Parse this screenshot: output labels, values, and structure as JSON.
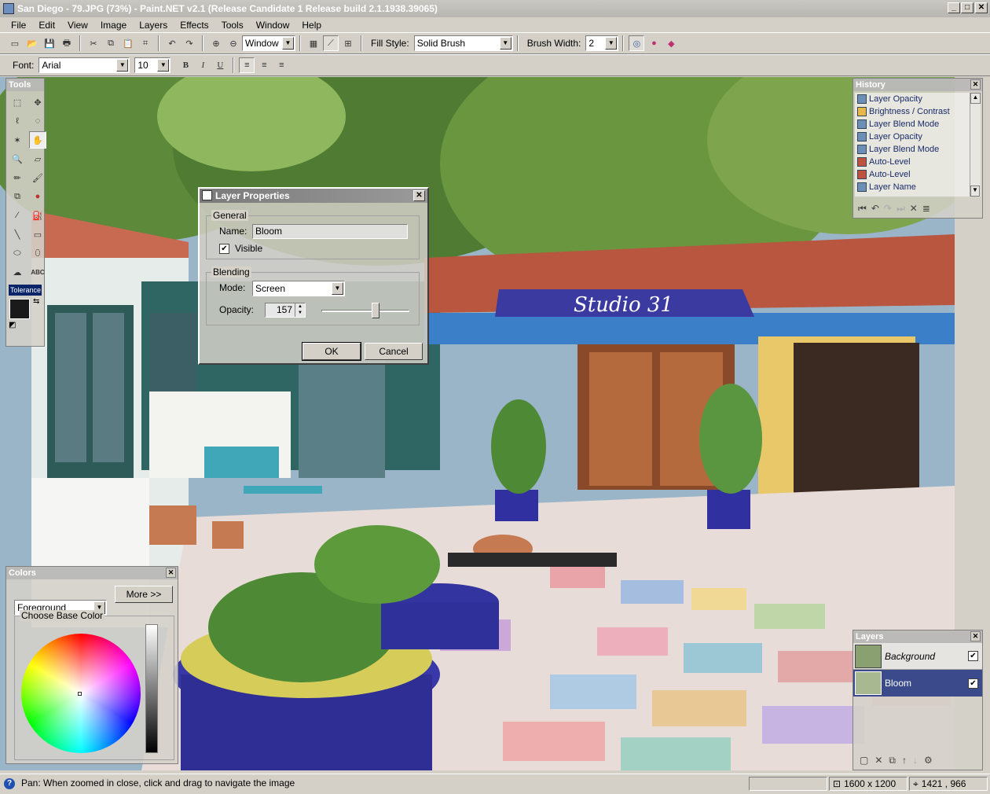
{
  "window": {
    "title": "San Diego - 79.JPG (73%) - Paint.NET v2.1 (Release Candidate 1 Release build 2.1.1938.39065)"
  },
  "menu": [
    "File",
    "Edit",
    "View",
    "Image",
    "Layers",
    "Effects",
    "Tools",
    "Window",
    "Help"
  ],
  "toolbar1": {
    "view_combo": "Window",
    "fill_style_label": "Fill Style:",
    "fill_style_value": "Solid Brush",
    "brush_width_label": "Brush Width:",
    "brush_width_value": "2"
  },
  "toolbar2": {
    "font_label": "Font:",
    "font_value": "Arial",
    "size_value": "10",
    "bold": "B",
    "italic": "I",
    "underline": "U"
  },
  "tools_panel": {
    "title": "Tools",
    "tolerance": "Tolerance"
  },
  "history_panel": {
    "title": "History",
    "items": [
      "Layer Opacity",
      "Brightness / Contrast",
      "Layer Blend Mode",
      "Layer Opacity",
      "Layer Blend Mode",
      "Auto-Level",
      "Auto-Level",
      "Layer Name"
    ]
  },
  "layers_panel": {
    "title": "Layers",
    "layers": [
      {
        "name": "Background",
        "visible": true,
        "selected": false
      },
      {
        "name": "Bloom",
        "visible": true,
        "selected": true
      }
    ]
  },
  "colors_panel": {
    "title": "Colors",
    "target": "Foreground",
    "more_button": "More >>",
    "group_label": "Choose Base Color"
  },
  "dialog": {
    "title": "Layer Properties",
    "general_label": "General",
    "name_label": "Name:",
    "name_value": "Bloom",
    "visible_label": "Visible",
    "blending_label": "Blending",
    "mode_label": "Mode:",
    "mode_value": "Screen",
    "opacity_label": "Opacity:",
    "opacity_value": "157",
    "opacity_fraction": 0.62,
    "ok": "OK",
    "cancel": "Cancel"
  },
  "canvas": {
    "sign_text": "Studio 31"
  },
  "status": {
    "message": "Pan: When zoomed in close, click and drag to navigate the image",
    "image_size": "1600 x 1200",
    "cursor": "1421 , 966"
  }
}
